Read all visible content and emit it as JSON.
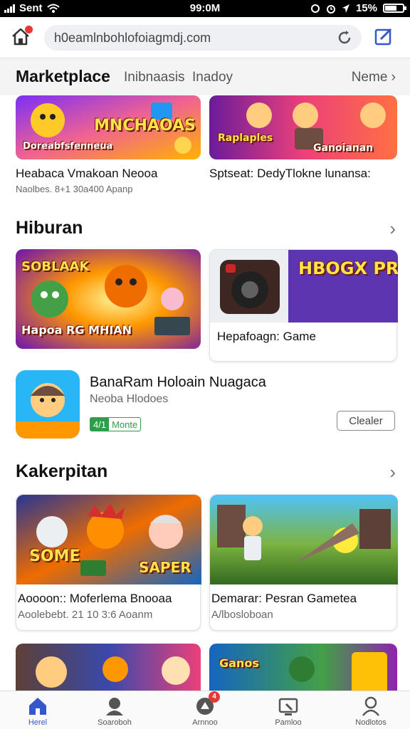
{
  "status_bar": {
    "carrier": "Sent",
    "time": "99:0M",
    "battery": "15%",
    "icons": [
      "signal-icon",
      "wifi-icon",
      "lock-rotation-icon",
      "alarm-icon",
      "location-icon",
      "battery-icon"
    ]
  },
  "browser": {
    "url": "h0eamlnbohlofoiagmdj.com",
    "icons": [
      "home-icon",
      "reload-icon",
      "edit-icon"
    ],
    "accent_color": "#3557c9"
  },
  "marketplace": {
    "title": "Marketplace",
    "tabs": [
      "Inibnaasis",
      "Inadoy"
    ],
    "more_label": "Neme"
  },
  "top_cards": [
    {
      "banner": "MNCHAOAS",
      "banner_sub": "Doreabfsfenneua",
      "title": "Heabaca Vmakoan Neooa",
      "subtitle": "Naolbes. 8+1 30a400 Apanp"
    },
    {
      "banner": "Ganoianan",
      "banner_sub": "Raplaples",
      "title": "Sptseat: DedyTlokne lunansa:",
      "subtitle": ""
    }
  ],
  "section_hiburan": {
    "title": "Hiburan",
    "cards": [
      {
        "banner": "SOBLAAK",
        "banner_sub": "Hapoa RG MHIAN",
        "title": ""
      },
      {
        "banner": "HBOGX PRAKES",
        "banner_sub": "",
        "title": "Hepafoagn: Game"
      }
    ],
    "feature": {
      "title": "BanaRam Holoain Nuagaca",
      "subtitle": "Neoba Hlodoes",
      "rating_score": "4/1",
      "rating_label": "Monte",
      "button": "Clealer"
    }
  },
  "section_kakerpitan": {
    "title": "Kakerpitan",
    "cards": [
      {
        "banner": "SOME",
        "banner_sub": "SAPER",
        "title": "Aoooon:: Moferlema Bnooaa",
        "subtitle": "Aoolebebt. 21 10 3:6 Aoanm"
      },
      {
        "banner": "",
        "banner_sub": "",
        "title": "Demarar: Pesran Gametea",
        "subtitle": "A/lbosloboan"
      }
    ]
  },
  "bottom_row_banner": "Ganos",
  "bottom_nav": [
    {
      "label": "Herel",
      "icon": "home-icon",
      "active": true
    },
    {
      "label": "Soaroboh",
      "icon": "search-person-icon",
      "active": false
    },
    {
      "label": "Arnnoo",
      "icon": "games-icon",
      "active": false,
      "badge": "4"
    },
    {
      "label": "Pamloo",
      "icon": "apps-icon",
      "active": false
    },
    {
      "label": "Nodlotos",
      "icon": "profile-icon",
      "active": false
    }
  ]
}
